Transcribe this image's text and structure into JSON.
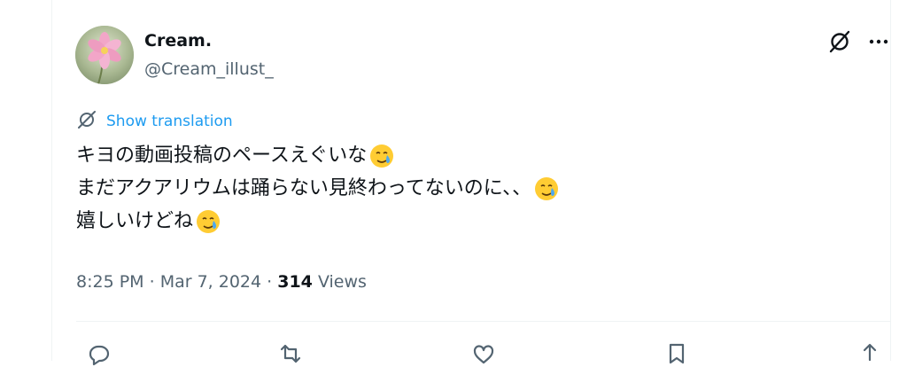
{
  "author": {
    "display_name": "Cream.",
    "handle": "@Cream_illust_"
  },
  "translate": {
    "label": "Show translation"
  },
  "tweet": {
    "lines": [
      "キヨの動画投稿のペースえぐいな",
      "まだアクアリウムは踊らない見終わってないのに、、",
      "嬉しいけどね"
    ],
    "emoji": "face-holding-back-tears"
  },
  "meta": {
    "time": "8:25 PM",
    "sep1": " · ",
    "date": "Mar 7, 2024",
    "sep2": " · ",
    "views_count": "314",
    "views_label": " Views"
  },
  "icons": {
    "translate": "grok-icon",
    "more": "more-horizontal-icon",
    "reply": "reply-icon",
    "repost": "repost-icon",
    "like": "like-icon",
    "bookmark": "bookmark-icon",
    "share": "share-icon"
  },
  "colors": {
    "link": "#1d9bf0",
    "secondary_text": "#536471",
    "primary_text": "#0f1419",
    "divider": "#eff3f4"
  }
}
